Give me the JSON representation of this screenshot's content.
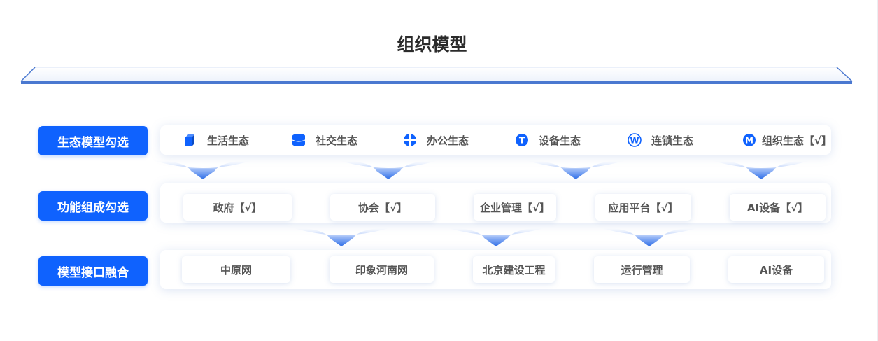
{
  "page": {
    "title": "组织模型"
  },
  "rows": {
    "ecology": {
      "label": "生态模型勾选",
      "items": [
        {
          "label": "生活生态",
          "icon": "cube-icon"
        },
        {
          "label": "社交生态",
          "icon": "database-icon"
        },
        {
          "label": "办公生态",
          "icon": "globe-icon"
        },
        {
          "label": "设备生态",
          "icon": "letter-t-icon"
        },
        {
          "label": "连锁生态",
          "icon": "letter-w-icon"
        },
        {
          "label": "组织生态【√】",
          "icon": "letter-m-icon"
        }
      ]
    },
    "function": {
      "label": "功能组成勾选",
      "items": [
        "政府【√】",
        "协会【√】",
        "企业管理【√】",
        "应用平台【√】",
        "AI设备【√】"
      ]
    },
    "interface": {
      "label": "模型接口融合",
      "items": [
        "中原网",
        "印象河南网",
        "北京建设工程",
        "运行管理",
        "AI设备"
      ]
    }
  },
  "colors": {
    "accent": "#0f62fe",
    "arrow": "#3b7bf0",
    "stage": "#4a78d0"
  },
  "icon_glyphs": {
    "t": "T",
    "w": "W",
    "m": "M"
  }
}
